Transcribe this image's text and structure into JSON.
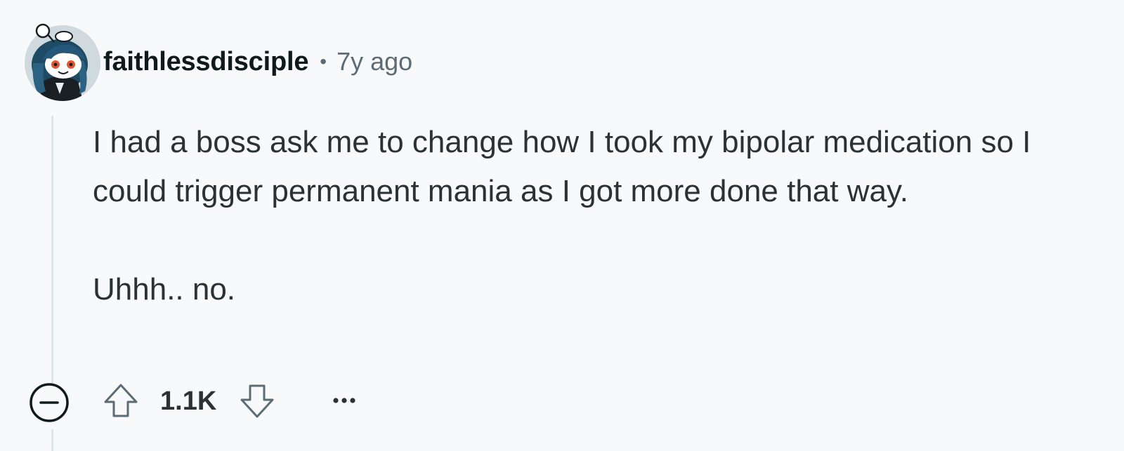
{
  "comment": {
    "author": {
      "username": "faithlessdisciple",
      "avatar_icon": "snoo-avatar-icon"
    },
    "separator": "•",
    "timestamp": "7y ago",
    "body": {
      "paragraph_1": "I had a boss ask me to change how I took my bipolar medication so I could trigger permanent mania as I got more done that way.",
      "paragraph_2": "Uhhh.. no."
    },
    "actions": {
      "collapse_icon": "collapse-icon",
      "upvote_icon": "upvote-arrow-icon",
      "score": "1.1K",
      "downvote_icon": "downvote-arrow-icon",
      "more_icon": "more-options-icon"
    }
  },
  "colors": {
    "background": "#f8f9fb",
    "text": "#2a3236",
    "username": "#0f1a1c",
    "muted": "#5c6c74",
    "thread_line": "#dde4ea"
  }
}
